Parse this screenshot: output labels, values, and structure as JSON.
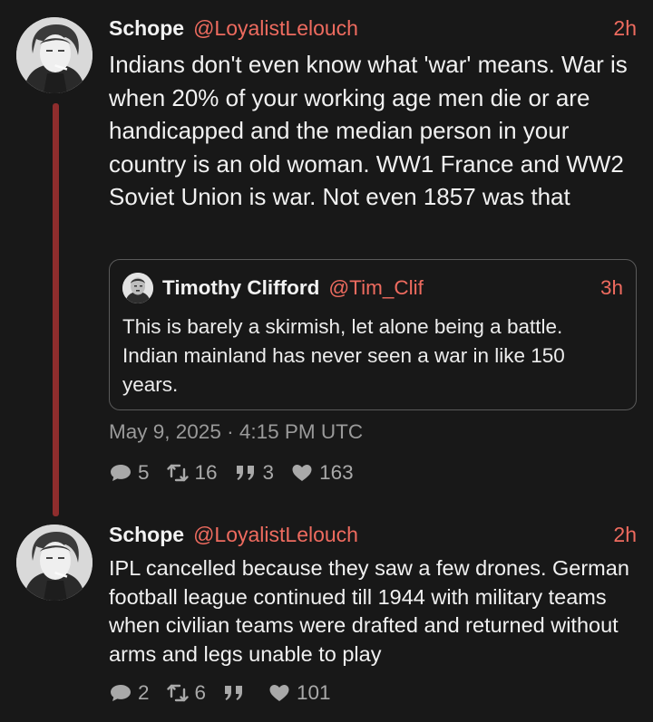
{
  "thread": {
    "posts": [
      {
        "author": "Schope",
        "handle": "@LoyalistLelouch",
        "time": "2h",
        "text": "Indians don't even know what 'war' means. War is when 20% of your working age men die or are handicapped and the median person in your country is an old woman. WW1 France and WW2 Soviet Union is war. Not even 1857 was that",
        "quote": {
          "author": "Timothy Clifford",
          "handle": "@Tim_Clif",
          "time": "3h",
          "text": "This is barely a skirmish, let alone being a battle. Indian mainland has never seen a war in like 150 years."
        },
        "timestamp": "May 9, 2025 · 4:15 PM UTC",
        "stats": {
          "replies": "5",
          "reposts": "16",
          "quotes": "3",
          "likes": "163"
        }
      },
      {
        "author": "Schope",
        "handle": "@LoyalistLelouch",
        "time": "2h",
        "text": "IPL cancelled because they saw a few drones. German football league continued till 1944 with military teams when civilian teams were drafted and returned without arms and legs unable to play",
        "stats": {
          "replies": "2",
          "reposts": "6",
          "quotes": "",
          "likes": "101"
        }
      }
    ]
  },
  "colors": {
    "background": "#181818",
    "accent": "#ee6b5f",
    "thread_line": "#8e2d2d",
    "muted": "#a9a9a9"
  },
  "icons": [
    "avatar",
    "reply-icon",
    "repost-icon",
    "quote-icon",
    "like-icon"
  ]
}
